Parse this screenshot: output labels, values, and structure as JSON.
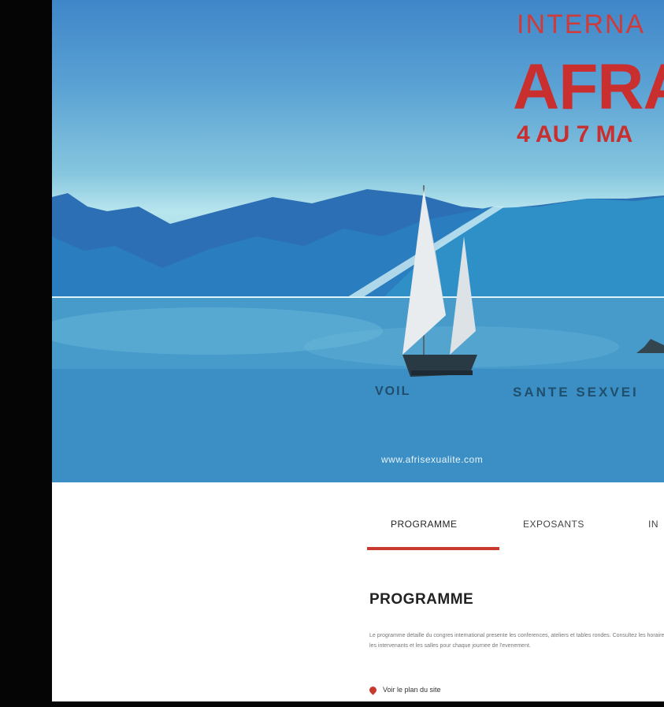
{
  "colors": {
    "accent_red": "#c92f2f",
    "tab_underline": "#c93a2e",
    "sky_top": "#3f86c9",
    "water": "#3a8bbd"
  },
  "hero": {
    "eyebrow": "INTERNA",
    "title": "AFRA",
    "dates": "4 AU 7 MA",
    "caption_left": "VOIL",
    "caption_right": "SANTE SEXVEI",
    "url": "www.afrisexualite.com"
  },
  "tabs": [
    {
      "label": "PROGRAMME",
      "active": true
    },
    {
      "label": "EXPOSANTS",
      "active": false
    },
    {
      "label": "IN",
      "active": false
    }
  ],
  "content": {
    "section_title": "PROGRAMME",
    "body_text": "Le programme detaille du congres international presente les conferences, ateliers et tables rondes. Consultez les horaires, les intervenants et les salles pour chaque journee de l'evenement.",
    "location_icon": "location-pin-icon",
    "location_text": "Voir le plan du site"
  }
}
